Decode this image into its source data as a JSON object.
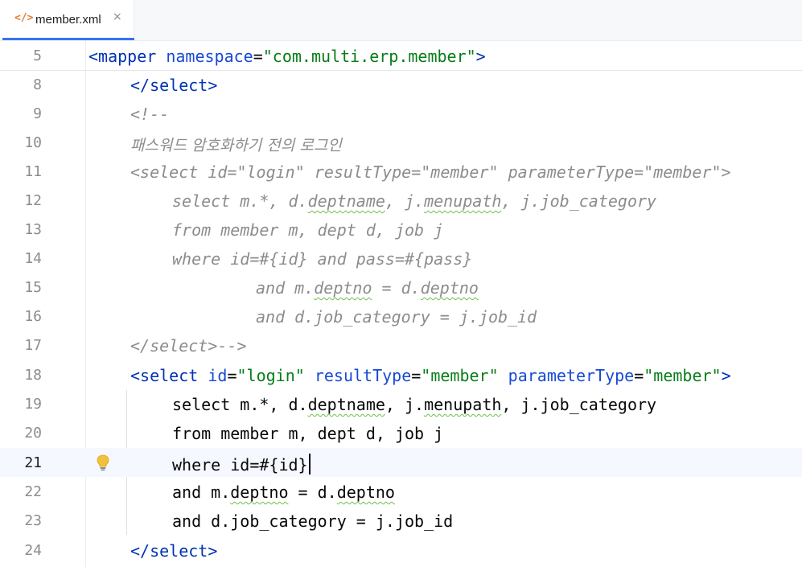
{
  "tab": {
    "icon_glyph": "</>",
    "title": "member.xml",
    "close_glyph": "×"
  },
  "sticky": {
    "line": "5",
    "open": "<",
    "tag": "mapper",
    "attr": "namespace",
    "eq": "=",
    "value": "\"com.multi.erp.member\"",
    "close": ">"
  },
  "lines": {
    "l8": {
      "num": "8",
      "text": "</",
      "tag": "select",
      "end": ">"
    },
    "l9": {
      "num": "9",
      "text": "<!--"
    },
    "l10": {
      "num": "10",
      "text": "패스워드 암호화하기 전의 로그인"
    },
    "l11": {
      "num": "11",
      "text": "<select id=\"login\" resultType=\"member\" parameterType=\"member\">"
    },
    "l12": {
      "num": "12",
      "a": "select m.*, d.",
      "w1": "deptname",
      "b": ", j.",
      "w2": "menupath",
      "c": ", j.job_category"
    },
    "l13": {
      "num": "13",
      "text": "from member m, dept d, job j"
    },
    "l14": {
      "num": "14",
      "text": "where id=#{id} and pass=#{pass}"
    },
    "l15": {
      "num": "15",
      "a": "and m.",
      "w1": "deptno",
      "b": " = d.",
      "w2": "deptno"
    },
    "l16": {
      "num": "16",
      "text": "and d.job_category = j.job_id"
    },
    "l17": {
      "num": "17",
      "text": "</select>-->"
    },
    "l18": {
      "num": "18",
      "open": "<",
      "tag": "select",
      "sp1": " ",
      "a1": "id",
      "eq1": "=",
      "v1": "\"login\"",
      "sp2": " ",
      "a2": "resultType",
      "eq2": "=",
      "v2": "\"member\"",
      "sp3": " ",
      "a3": "parameterType",
      "eq3": "=",
      "v3": "\"member\"",
      "close": ">"
    },
    "l19": {
      "num": "19",
      "a": "select m.*, d.",
      "w1": "deptname",
      "b": ", j.",
      "w2": "menupath",
      "c": ", j.job_category"
    },
    "l20": {
      "num": "20",
      "text": "from member m, dept d, job j"
    },
    "l21": {
      "num": "21",
      "text": "where id=#{id}"
    },
    "l22": {
      "num": "22",
      "a": "and m.",
      "w1": "deptno",
      "b": " = d.",
      "w2": "deptno"
    },
    "l23": {
      "num": "23",
      "text": "and d.job_category = j.job_id"
    },
    "l24": {
      "num": "24",
      "text": "</",
      "tag": "select",
      "end": ">"
    }
  },
  "gutter_icon": "lightbulb-icon",
  "colors": {
    "tag": "#0033b3",
    "attr": "#174ad4",
    "string": "#067d17",
    "comment": "#8c8c8c",
    "accent": "#3574f0",
    "bulb": "#f2c13c"
  }
}
